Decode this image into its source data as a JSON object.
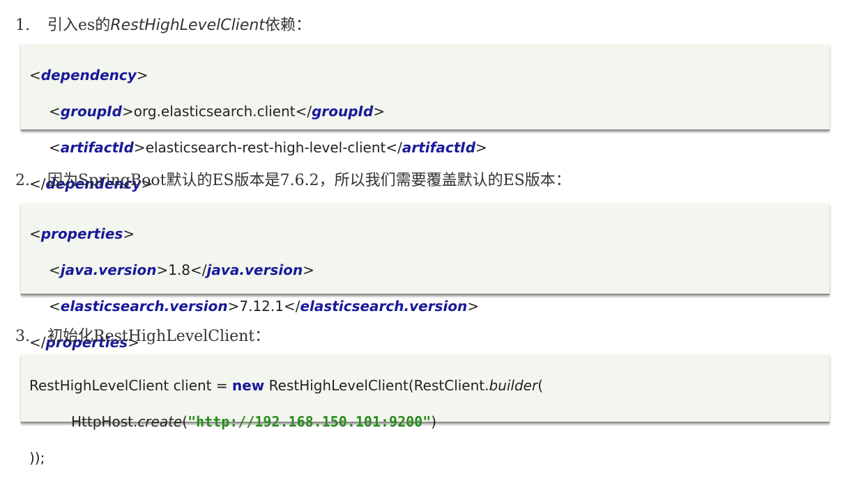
{
  "step1": {
    "number": "1.",
    "prefix": "引入es的",
    "emphasis": "RestHighLevelClient",
    "suffix": "依赖："
  },
  "code1": {
    "dep_open_lt": "<",
    "dep_tag": "dependency",
    "dep_open_gt": ">",
    "group_open_lt": "<",
    "group_tag": "groupId",
    "group_open_gt": ">",
    "group_value": "org.elasticsearch.client",
    "group_close_lt": "</",
    "group_close_tag": "groupId",
    "group_close_gt": ">",
    "artifact_open_lt": "<",
    "artifact_tag": "artifactId",
    "artifact_open_gt": ">",
    "artifact_value": "elasticsearch-rest-high-level-client",
    "artifact_close_lt": "</",
    "artifact_close_tag": "artifactId",
    "artifact_close_gt": ">",
    "dep_close_lt": "</",
    "dep_close_tag": "dependency",
    "dep_close_gt": ">"
  },
  "step2": {
    "number": "2.",
    "text": "因为SpringBoot默认的ES版本是7.6.2，所以我们需要覆盖默认的ES版本："
  },
  "code2": {
    "props_open_lt": "<",
    "props_tag": "properties",
    "props_open_gt": ">",
    "java_open_lt": "<",
    "java_tag": "java.version",
    "java_open_gt": ">",
    "java_value": "1.8",
    "java_close_lt": "</",
    "java_close_tag": "java.version",
    "java_close_gt": ">",
    "es_open_lt": "<",
    "es_tag": "elasticsearch.version",
    "es_open_gt": ">",
    "es_value": "7.12.1",
    "es_close_lt": "</",
    "es_close_tag": "elasticsearch.version",
    "es_close_gt": ">",
    "props_close_lt": "</",
    "props_close_tag": "properties",
    "props_close_gt": ">"
  },
  "step3": {
    "number": "3.",
    "text": "初始化RestHighLevelClient："
  },
  "code3": {
    "l1_a": "RestHighLevelClient client = ",
    "l1_kw": "new",
    "l1_b": " RestHighLevelClient(RestClient.",
    "l1_method": "builder",
    "l1_c": "(",
    "l2_a": "HttpHost.",
    "l2_method": "create",
    "l2_b": "(",
    "l2_str": "\"http://192.168.150.101:9200\"",
    "l2_c": ")",
    "l3": "));"
  }
}
